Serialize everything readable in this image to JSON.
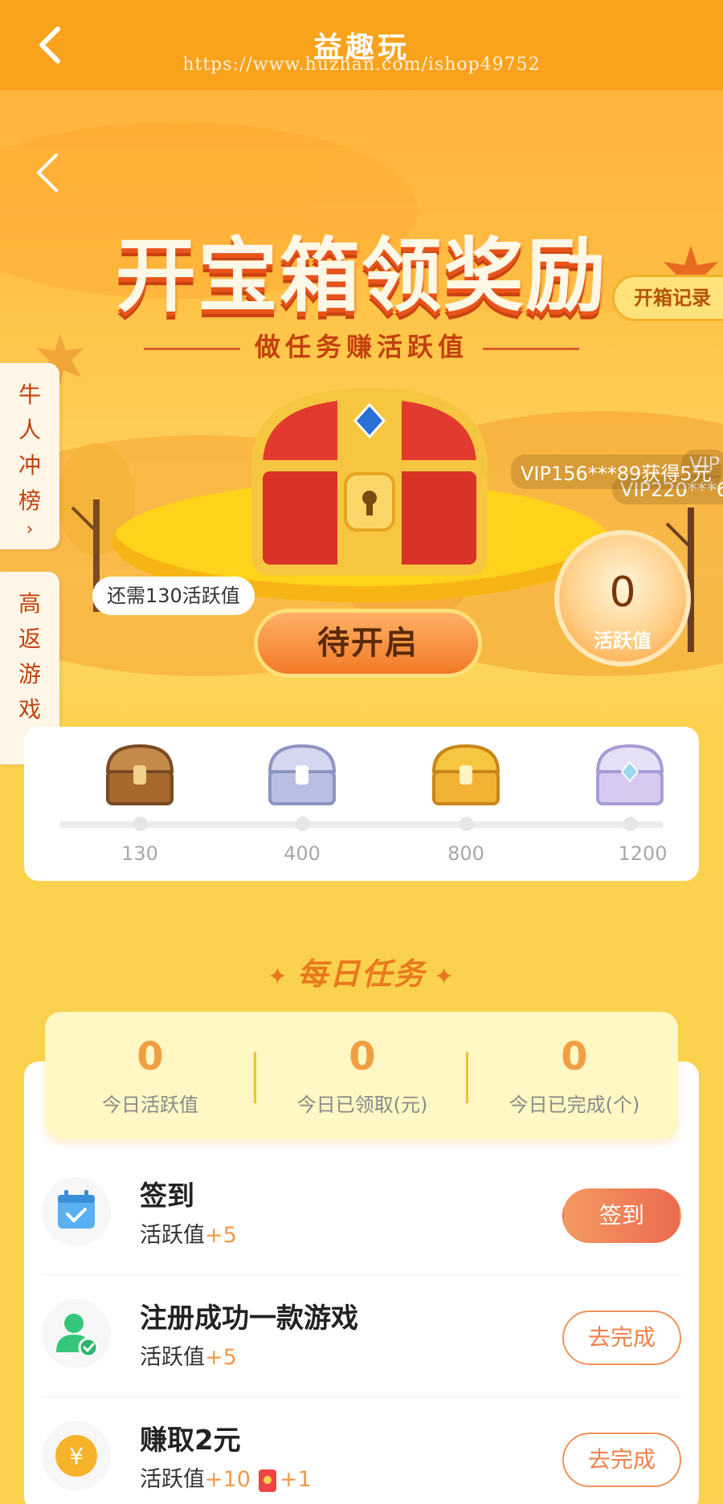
{
  "topbar": {
    "title": "益趣玩",
    "watermark": "https://www.huzhan.com/ishop49752"
  },
  "hero": {
    "headline": "开宝箱领奖励",
    "subline": "做任务赚活跃值",
    "record_label": "开箱记录",
    "tickers": [
      "VIP",
      "VIP220***6",
      "VIP156***89获得5元"
    ],
    "need_text": "还需130活跃值",
    "open_label": "待开启",
    "gauge_value": "0",
    "gauge_label": "活跃值"
  },
  "side_tabs": [
    {
      "chars": [
        "牛",
        "人",
        "冲",
        "榜"
      ],
      "chevron": "›"
    },
    {
      "chars": [
        "高",
        "返",
        "游",
        "戏"
      ],
      "chevron": "›"
    }
  ],
  "milestones": [
    {
      "value": "130",
      "chest": "bronze-chest-icon",
      "color": "#c48a4a"
    },
    {
      "value": "400",
      "chest": "silver-chest-icon",
      "color": "#b9bfe3"
    },
    {
      "value": "800",
      "chest": "gold-chest-icon",
      "color": "#f2b233"
    },
    {
      "value": "1200",
      "chest": "diamond-chest-icon",
      "color": "#d6c8f0"
    }
  ],
  "daily": {
    "title": "每日任务",
    "stats": [
      {
        "value": "0",
        "label": "今日活跃值"
      },
      {
        "value": "0",
        "label": "今日已领取(元)"
      },
      {
        "value": "0",
        "label": "今日已完成(个)"
      }
    ],
    "tasks": [
      {
        "name": "签到",
        "reward_prefix": "活跃值",
        "reward_plus": "+5",
        "button": "签到",
        "icon": "calendar-icon"
      },
      {
        "name": "注册成功一款游戏",
        "reward_prefix": "活跃值",
        "reward_plus": "+5",
        "button": "去完成",
        "icon": "user-check-icon"
      },
      {
        "name": "赚取2元",
        "reward_prefix": "活跃值",
        "reward_plus": "+10",
        "extra_plus": "+1",
        "button": "去完成",
        "icon": "yuan-coin-icon"
      }
    ]
  },
  "colors": {
    "brand_orange": "#f9a21b",
    "accent_text": "#f09a4c",
    "button_gradient": "#ec6a4f"
  }
}
